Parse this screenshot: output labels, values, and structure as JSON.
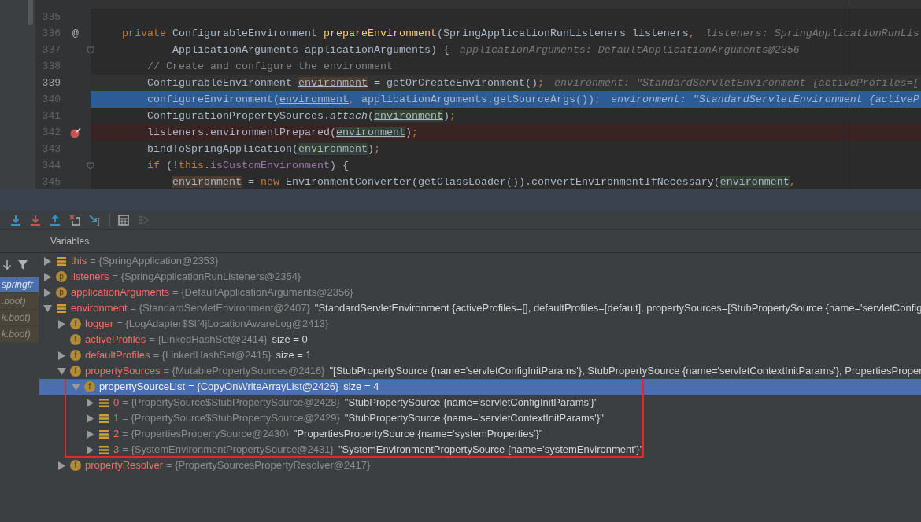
{
  "editor": {
    "lines": [
      {
        "number": "335",
        "kind": "none",
        "fold": false
      },
      {
        "number": "336",
        "kind": "none",
        "fold": false,
        "gutter_mark": "@",
        "code": [
          {
            "kind": "kw",
            "t": "    private "
          },
          {
            "kind": "plain",
            "t": "ConfigurableEnvironment "
          },
          {
            "kind": "method",
            "t": "prepareEnvironment"
          },
          {
            "kind": "plain",
            "t": "(SpringApplicationRunListeners listeners"
          },
          {
            "kind": "punct",
            "t": ","
          }
        ],
        "hint": "listeners: SpringApplicationRunLis"
      },
      {
        "number": "337",
        "kind": "none",
        "fold": true,
        "code": [
          {
            "kind": "plain",
            "t": "            ApplicationArguments applicationArguments) {"
          }
        ],
        "hint": "applicationArguments: DefaultApplicationArguments@2356"
      },
      {
        "number": "338",
        "kind": "none",
        "fold": false,
        "code": [
          {
            "kind": "comment",
            "t": "        // Create and configure the environment"
          }
        ]
      },
      {
        "number": "339",
        "kind": "current",
        "fold": false,
        "code": [
          {
            "kind": "plain",
            "t": "        ConfigurableEnvironment "
          },
          {
            "kind": "var_write",
            "t": "environment"
          },
          {
            "kind": "plain",
            "t": " = getOrCreateEnvironment()"
          },
          {
            "kind": "punct",
            "t": ";"
          }
        ],
        "hint": "environment: \"StandardServletEnvironment {activeProfiles=["
      },
      {
        "number": "340",
        "kind": "execution",
        "fold": false,
        "code": [
          {
            "kind": "plain",
            "t": "        configureEnvironment("
          },
          {
            "kind": "var",
            "t": "environment"
          },
          {
            "kind": "punct",
            "t": ", "
          },
          {
            "kind": "plain",
            "t": "applicationArguments.getSourceArgs())"
          },
          {
            "kind": "punct",
            "t": ";"
          }
        ],
        "hint": "environment: \"StandardServletEnvironment {activeP"
      },
      {
        "number": "341",
        "kind": "none",
        "fold": false,
        "code": [
          {
            "kind": "plain",
            "t": "        ConfigurationPropertySources."
          },
          {
            "kind": "static",
            "t": "attach"
          },
          {
            "kind": "plain",
            "t": "("
          },
          {
            "kind": "var_read",
            "t": "environment"
          },
          {
            "kind": "plain",
            "t": ")"
          },
          {
            "kind": "punct",
            "t": ";"
          }
        ]
      },
      {
        "number": "342",
        "kind": "breakpoint",
        "fold": false,
        "breakpoint": true,
        "code": [
          {
            "kind": "plain",
            "t": "        listeners.environmentPrepared("
          },
          {
            "kind": "var_read",
            "t": "environment"
          },
          {
            "kind": "plain",
            "t": ")"
          },
          {
            "kind": "punct",
            "t": ";"
          }
        ]
      },
      {
        "number": "343",
        "kind": "none",
        "fold": false,
        "code": [
          {
            "kind": "plain",
            "t": "        bindToSpringApplication("
          },
          {
            "kind": "var_read",
            "t": "environment"
          },
          {
            "kind": "plain",
            "t": ")"
          },
          {
            "kind": "punct",
            "t": ";"
          }
        ]
      },
      {
        "number": "344",
        "kind": "none",
        "fold": true,
        "code": [
          {
            "kind": "kw",
            "t": "        if "
          },
          {
            "kind": "plain",
            "t": "(!"
          },
          {
            "kind": "kw",
            "t": "this"
          },
          {
            "kind": "plain",
            "t": "."
          },
          {
            "kind": "field",
            "t": "isCustomEnvironment"
          },
          {
            "kind": "plain",
            "t": ") {"
          }
        ]
      },
      {
        "number": "345",
        "kind": "none",
        "fold": false,
        "code": [
          {
            "kind": "var_write",
            "t": "            environment"
          },
          {
            "kind": "plain",
            "t": " = "
          },
          {
            "kind": "kw",
            "t": "new "
          },
          {
            "kind": "plain",
            "t": "EnvironmentConverter(getClassLoader()).convertEnvironmentIfNecessary("
          },
          {
            "kind": "var_read",
            "t": "environment"
          },
          {
            "kind": "punct",
            "t": ","
          }
        ]
      }
    ]
  },
  "frames": {
    "items": [
      {
        "label": "springfr",
        "selected": true
      },
      {
        "label": ".boot)",
        "selected": false
      },
      {
        "label": "k.boot)",
        "selected": false
      },
      {
        "label": "k.boot)",
        "selected": false
      }
    ]
  },
  "variables": {
    "title": "Variables",
    "items": [
      {
        "kind": "local",
        "name": "this",
        "type": "= {SpringApplication@2353}",
        "expanded": false,
        "has_children": true,
        "selected": false
      },
      {
        "kind": "param",
        "badge": "p",
        "name": "listeners",
        "type": "= {SpringApplicationRunListeners@2354}",
        "expanded": false,
        "has_children": true,
        "selected": false
      },
      {
        "kind": "param",
        "badge": "p",
        "name": "applicationArguments",
        "type": "= {DefaultApplicationArguments@2356}",
        "expanded": false,
        "has_children": true,
        "selected": false
      },
      {
        "kind": "local",
        "name": "environment",
        "type": "= {StandardServletEnvironment@2407}",
        "value": "\"StandardServletEnvironment {activeProfiles=[], defaultProfiles=[default], propertySources=[StubPropertySource {name='servletConfig",
        "expanded": true,
        "has_children": true,
        "selected": false,
        "children": [
          {
            "kind": "field",
            "badge": "f",
            "name": "logger",
            "type": "= {LogAdapter$Slf4jLocationAwareLog@2413}",
            "expanded": false,
            "has_children": true,
            "selected": false
          },
          {
            "kind": "field",
            "badge": "f",
            "name": "activeProfiles",
            "type": "= {LinkedHashSet@2414}",
            "value": "size = 0",
            "has_children": false,
            "selected": false
          },
          {
            "kind": "field",
            "badge": "f",
            "name": "defaultProfiles",
            "type": "= {LinkedHashSet@2415}",
            "value": "size = 1",
            "expanded": false,
            "has_children": true,
            "selected": false
          },
          {
            "kind": "field",
            "badge": "f",
            "name": "propertySources",
            "type": "= {MutablePropertySources@2416}",
            "value": "\"[StubPropertySource {name='servletConfigInitParams'}, StubPropertySource {name='servletContextInitParams'}, PropertiesProper",
            "expanded": true,
            "has_children": true,
            "selected": false,
            "children": [
              {
                "kind": "field",
                "badge": "f",
                "name": "propertySourceList",
                "type": "= {CopyOnWriteArrayList@2426}",
                "value": "size = 4",
                "expanded": true,
                "has_children": true,
                "selected": true,
                "children": [
                  {
                    "kind": "local",
                    "name": "0",
                    "type": "= {PropertySource$StubPropertySource@2428}",
                    "value": "\"StubPropertySource {name='servletConfigInitParams'}\"",
                    "expanded": false,
                    "has_children": true,
                    "selected": false
                  },
                  {
                    "kind": "local",
                    "name": "1",
                    "type": "= {PropertySource$StubPropertySource@2429}",
                    "value": "\"StubPropertySource {name='servletContextInitParams'}\"",
                    "expanded": false,
                    "has_children": true,
                    "selected": false
                  },
                  {
                    "kind": "local",
                    "name": "2",
                    "type": "= {PropertiesPropertySource@2430}",
                    "value": "\"PropertiesPropertySource {name='systemProperties'}\"",
                    "expanded": false,
                    "has_children": true,
                    "selected": false
                  },
                  {
                    "kind": "local",
                    "name": "3",
                    "type": "= {SystemEnvironmentPropertySource@2431}",
                    "value": "\"SystemEnvironmentPropertySource {name='systemEnvironment'}\"",
                    "expanded": false,
                    "has_children": true,
                    "selected": false
                  }
                ]
              }
            ]
          },
          {
            "kind": "field",
            "badge": "f",
            "name": "propertyResolver",
            "type": "= {PropertySourcesPropertyResolver@2417}",
            "expanded": false,
            "has_children": true,
            "selected": false
          }
        ]
      }
    ]
  }
}
